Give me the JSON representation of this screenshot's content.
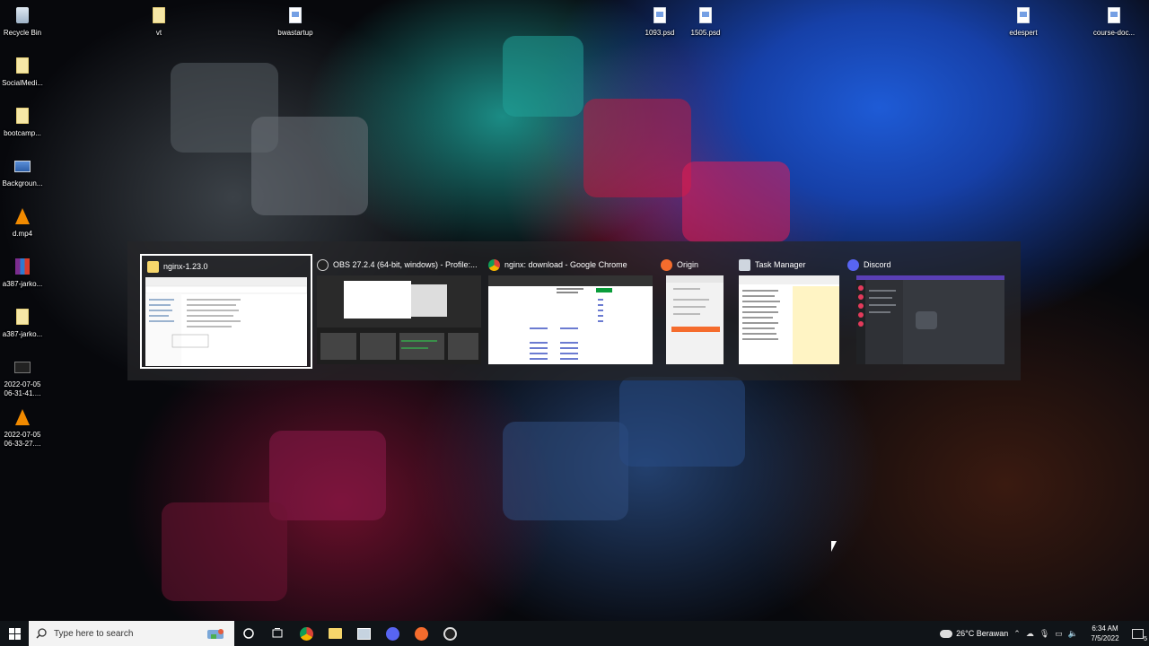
{
  "desktop": {
    "icons": [
      {
        "label": "Recycle Bin",
        "icon": "recycle-bin-icon"
      },
      {
        "label": "vt",
        "icon": "folder-icon"
      },
      {
        "label": "bwastartup",
        "icon": "folder-icon"
      },
      {
        "label": "1093.psd",
        "icon": "document-icon"
      },
      {
        "label": "1505.psd",
        "icon": "document-icon"
      },
      {
        "label": "edespert",
        "icon": "document-icon"
      },
      {
        "label": "course-doc...",
        "icon": "document-icon"
      },
      {
        "label": "SocialMedi...",
        "icon": "folder-icon"
      },
      {
        "label": "bootcamp...",
        "icon": "folder-icon"
      },
      {
        "label": "Backgroun...",
        "icon": "image-icon"
      },
      {
        "label": "d.mp4",
        "icon": "vlc-icon"
      },
      {
        "label": "a387-jarko...",
        "icon": "winrar-icon"
      },
      {
        "label": "a387-jarko...",
        "icon": "folder-icon"
      },
      {
        "label": "2022-07-05\n06-31-41....",
        "icon": "video-thumbnail-icon"
      },
      {
        "label": "2022-07-05\n06-33-27....",
        "icon": "vlc-icon"
      }
    ]
  },
  "switcher": {
    "windows": [
      {
        "title": "nginx-1.23.0",
        "icon": "folder-icon",
        "selected": true
      },
      {
        "title": "OBS 27.2.4 (64-bit, windows) - Profile:...",
        "icon": "obs-icon"
      },
      {
        "title": "nginx: download - Google Chrome",
        "icon": "chrome-icon"
      },
      {
        "title": "Origin",
        "icon": "origin-icon"
      },
      {
        "title": "Task Manager",
        "icon": "task-manager-icon"
      },
      {
        "title": "Discord",
        "icon": "discord-icon"
      }
    ]
  },
  "taskbar": {
    "search_placeholder": "Type here to search",
    "weather": "26°C  Berawan",
    "time": "6:34 AM",
    "date": "7/5/2022",
    "notification_count": "5",
    "pinned": [
      "Chrome",
      "File Explorer",
      "Task Manager",
      "Discord",
      "Origin",
      "OBS"
    ]
  }
}
